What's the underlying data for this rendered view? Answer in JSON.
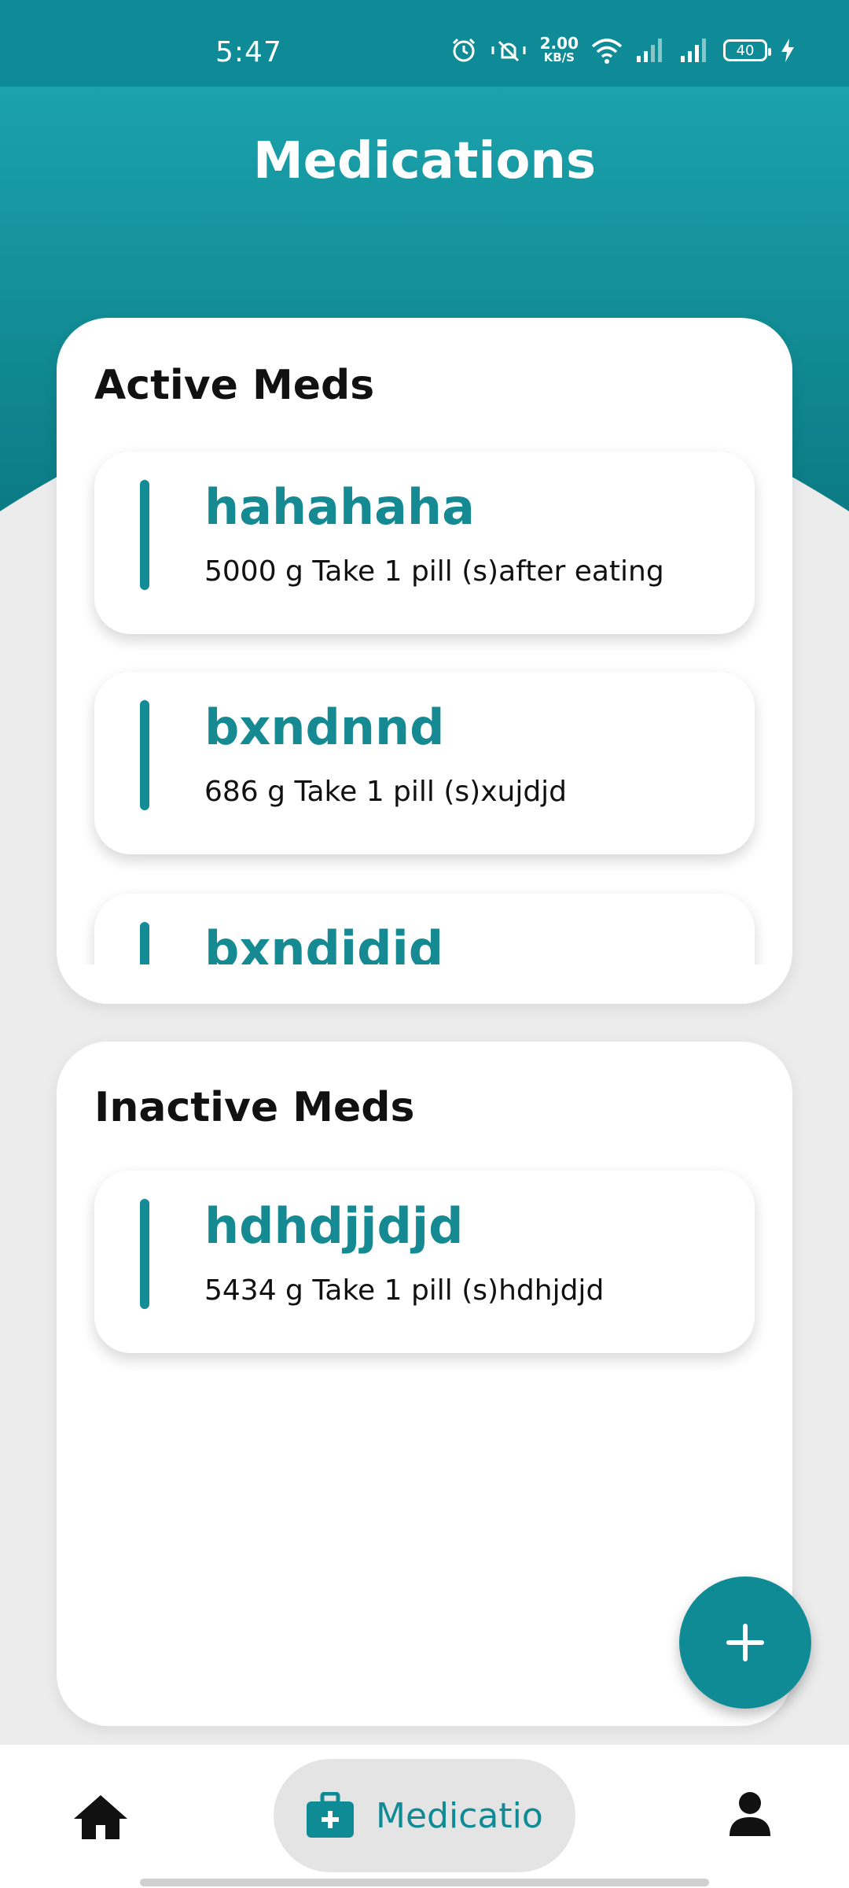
{
  "status_bar": {
    "time": "5:47",
    "speed_value": "2.00",
    "speed_unit": "KB/S",
    "battery": "40",
    "icons": [
      "alarm-icon",
      "mute-icon",
      "wifi-icon",
      "signal-icon",
      "signal-icon",
      "battery-icon",
      "charging-icon"
    ]
  },
  "header": {
    "title": "Medications"
  },
  "colors": {
    "accent": "#0f8b95",
    "header_top": "#1eaab5",
    "header_bottom": "#0b7b84"
  },
  "active": {
    "title": "Active Meds",
    "meds": [
      {
        "name": "hahahaha",
        "detail": "5000 g Take 1 pill (s)after eating"
      },
      {
        "name": "bxndnnd",
        "detail": "686 g Take 1 pill (s)xujdjd"
      },
      {
        "name": "bxndjdjd",
        "detail": ""
      }
    ]
  },
  "inactive": {
    "title": "Inactive Meds",
    "meds": [
      {
        "name": "hdhdjjdjd",
        "detail": "5434 g Take 1 pill (s)hdhjdjd"
      }
    ]
  },
  "fab": {
    "icon": "plus-icon"
  },
  "bottom_nav": {
    "items": [
      {
        "icon": "home-icon",
        "label": ""
      },
      {
        "icon": "medical-bag-icon",
        "label": "Medicatio"
      },
      {
        "icon": "profile-icon",
        "label": ""
      }
    ]
  }
}
